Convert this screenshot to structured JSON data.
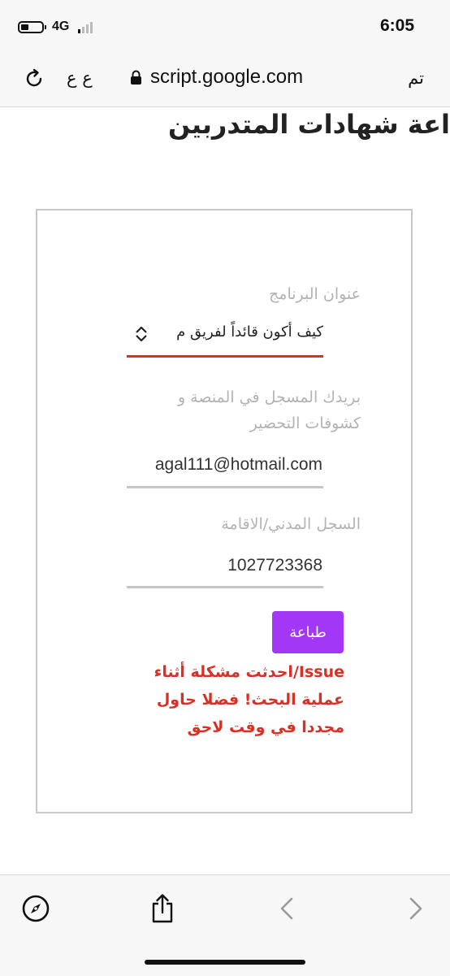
{
  "status_bar": {
    "network": "4G",
    "time": "6:05",
    "icons": [
      "battery-icon",
      "signal-icon"
    ]
  },
  "browser": {
    "url": "script.google.com",
    "text_size_label": "ع ع",
    "done_label": "تم",
    "icons": [
      "reload-icon",
      "lock-icon"
    ]
  },
  "page": {
    "title": "اعة شهادات المتدربين"
  },
  "form": {
    "program": {
      "label": "عنوان البرنامج",
      "selected": "كيف أكون قائداً لفريق م"
    },
    "email": {
      "label": "بريدك المسجل في المنصة و كشوفات التحضير",
      "value": "agal111@hotmail.com"
    },
    "civil_id": {
      "label": "السجل المدني/الاقامة",
      "value": "1027723368"
    },
    "print_button": "طباعة",
    "error": "Issue/احدثت مشكلة أثناء عملية البحث! فضلا حاول مجددا في وقت لاحق",
    "accent_color": "#d93025",
    "button_color": "#a237f5"
  },
  "toolbar": {
    "icons": [
      "compass-icon",
      "share-icon",
      "back-icon",
      "forward-icon"
    ]
  }
}
